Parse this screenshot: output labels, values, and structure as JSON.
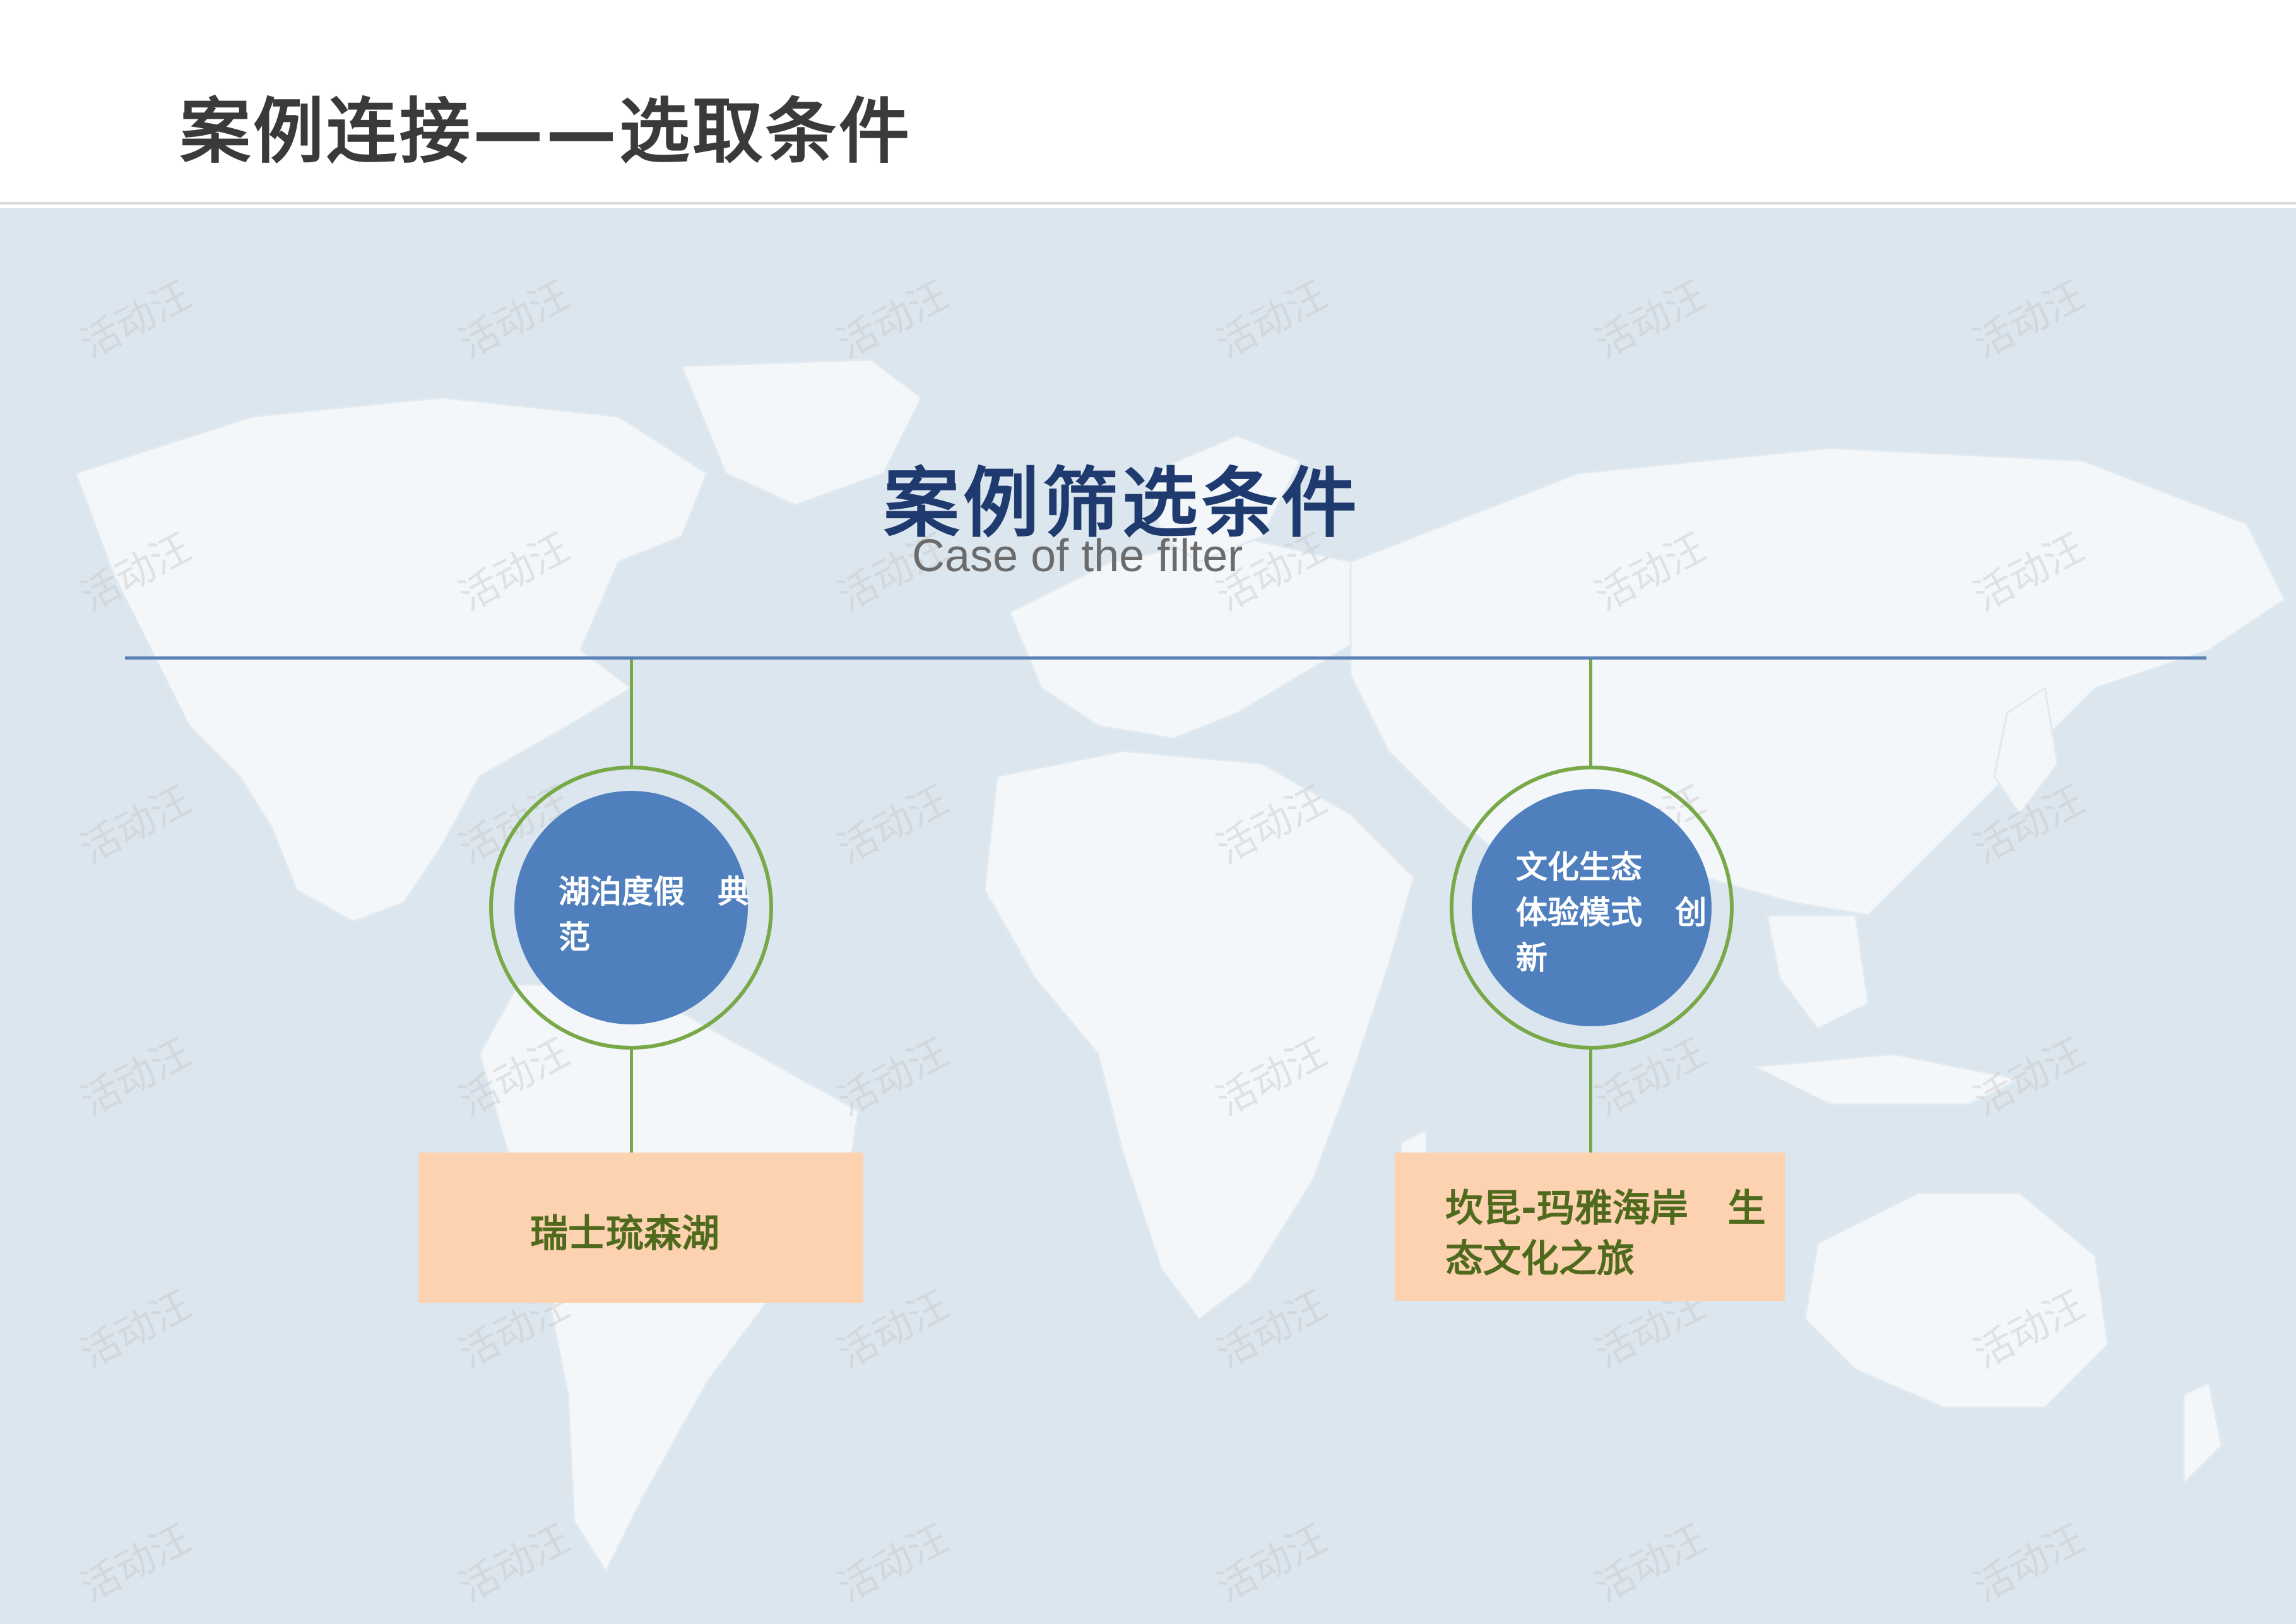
{
  "header": {
    "title": "案例连接——选取条件"
  },
  "main": {
    "title": "案例筛选条件",
    "subtitle": "Case of the filter"
  },
  "nodes": [
    {
      "circle_label": "湖泊度假   典\n范",
      "box_label": "瑞士琉森湖"
    },
    {
      "circle_label": "文化生态\n体验模式   创\n新",
      "box_label": "坎昆-玛雅海岸   生\n态文化之旅"
    }
  ],
  "watermark": {
    "text": "活动汪"
  },
  "colors": {
    "accent_line": "#5b82b5",
    "node_fill": "#4f7fbd",
    "ring": "#78a848",
    "box_fill": "#fcd2b1",
    "box_text": "#4f6a1c",
    "title": "#1f3a6e",
    "map_bg": "#dce6ee",
    "land": "#f2f6f9"
  }
}
